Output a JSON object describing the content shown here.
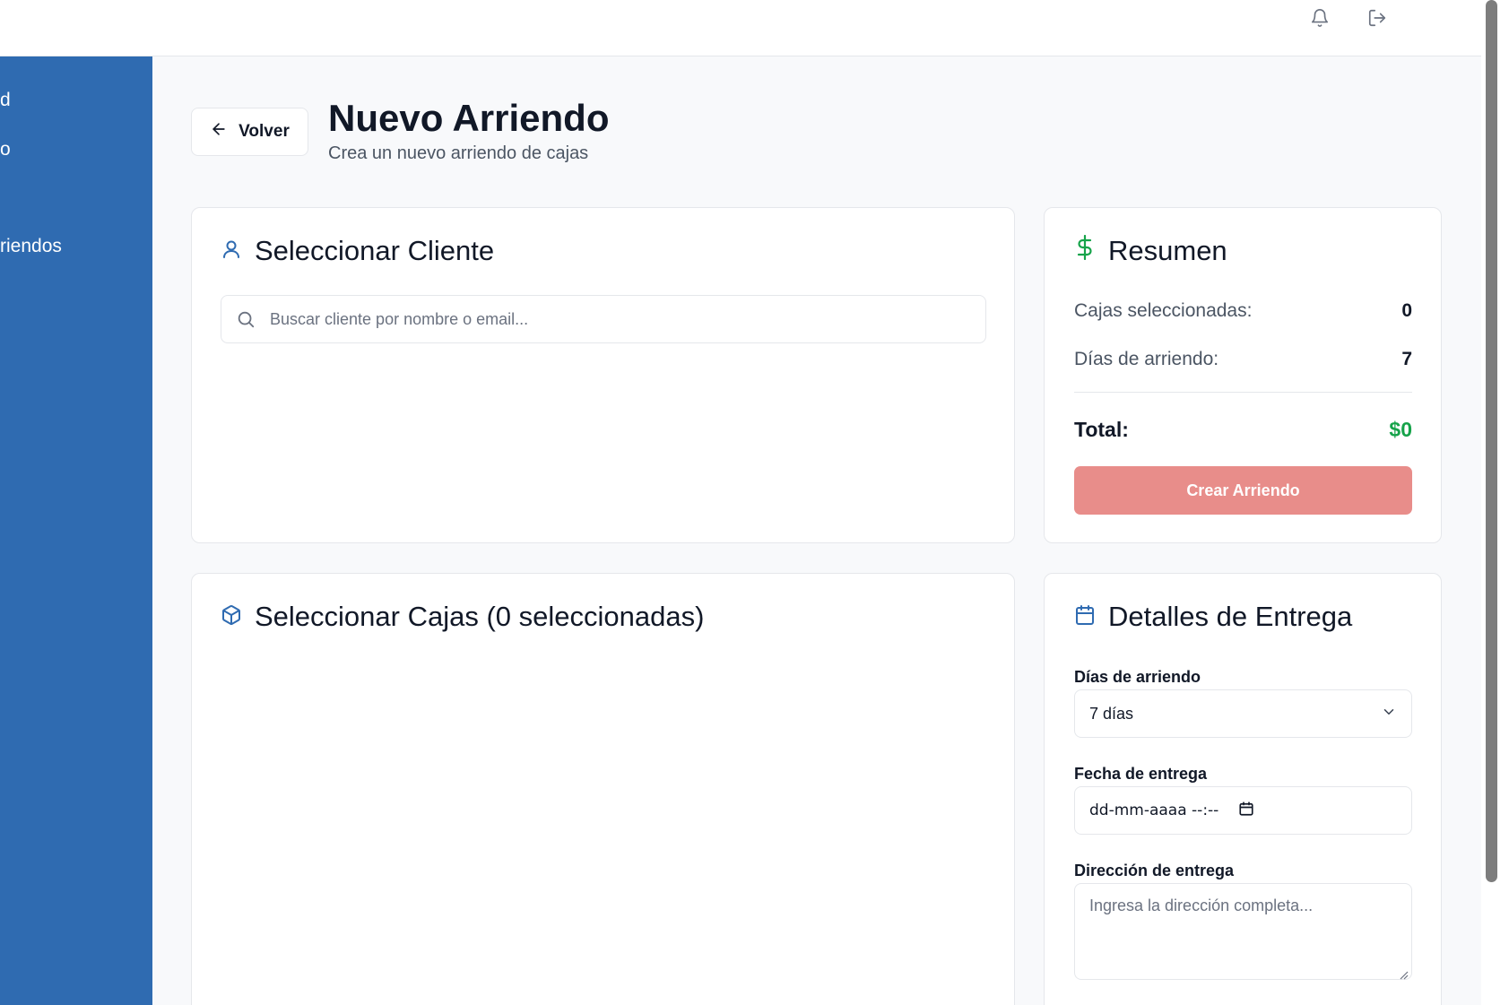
{
  "header": {
    "notifications_icon": "bell-icon",
    "logout_icon": "logout-icon"
  },
  "sidebar": {
    "items": [
      {
        "label": "d"
      },
      {
        "label": "o"
      },
      {
        "label": "riendos"
      }
    ]
  },
  "page": {
    "back_label": "Volver",
    "title": "Nuevo Arriendo",
    "subtitle": "Crea un nuevo arriendo de cajas"
  },
  "client_card": {
    "title": "Seleccionar Cliente",
    "search_placeholder": "Buscar cliente por nombre o email...",
    "search_value": ""
  },
  "boxes_card": {
    "title": "Seleccionar Cajas (0 seleccionadas)"
  },
  "summary": {
    "title": "Resumen",
    "boxes_label": "Cajas seleccionadas:",
    "boxes_value": "0",
    "days_label": "Días de arriendo:",
    "days_value": "7",
    "total_label": "Total:",
    "total_value": "$0",
    "create_label": "Crear Arriendo"
  },
  "delivery": {
    "title": "Detalles de Entrega",
    "days_label": "Días de arriendo",
    "days_selected": "7 días",
    "date_label": "Fecha de entrega",
    "date_value": "dd-mm-aaaa --:--",
    "address_label": "Dirección de entrega",
    "address_placeholder": "Ingresa la dirección completa..."
  },
  "colors": {
    "sidebar": "#2f6bb1",
    "accent_blue": "#2f6bb1",
    "money_green": "#16a34a",
    "create_button": "#e88d8a"
  }
}
